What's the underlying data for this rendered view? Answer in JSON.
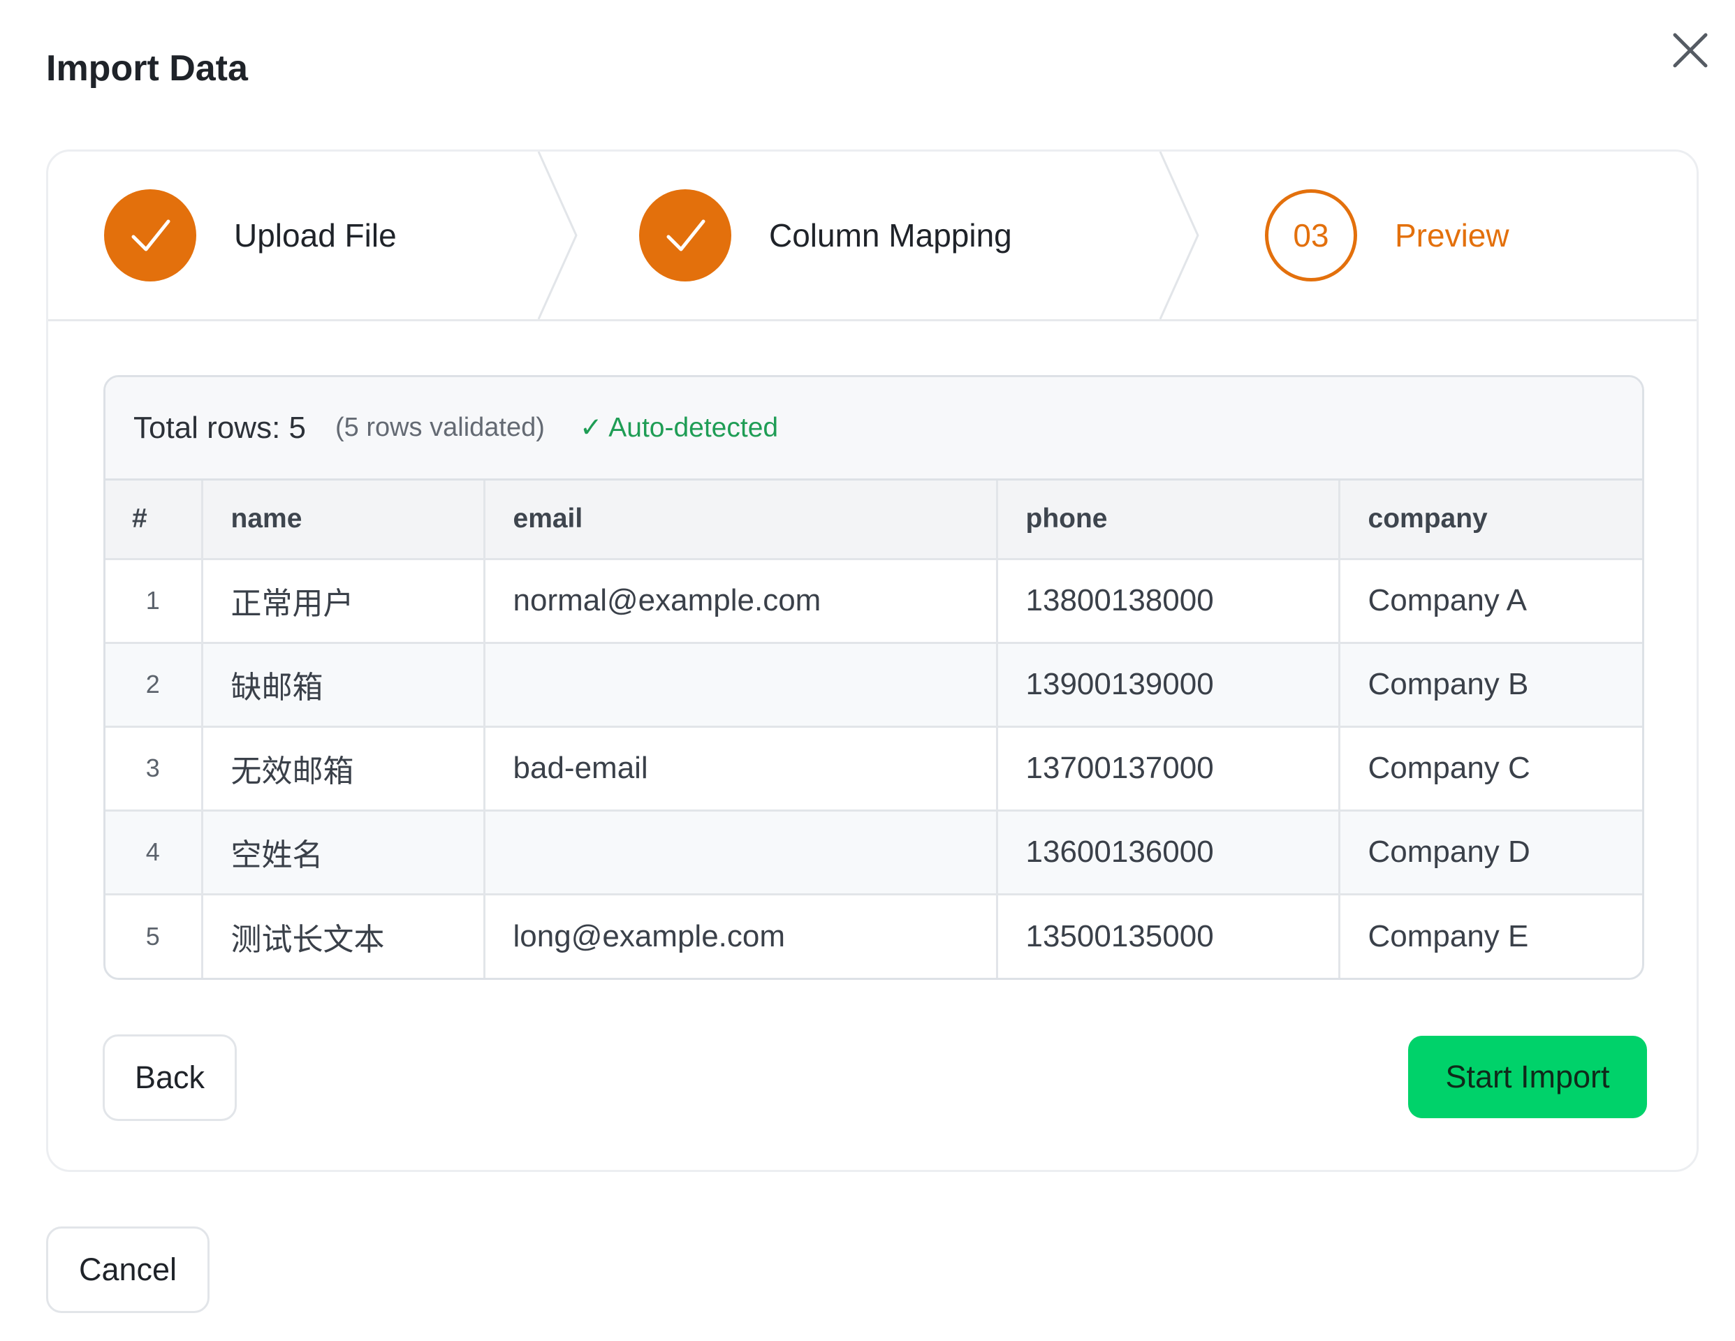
{
  "dialog": {
    "title": "Import Data",
    "close_icon": "close-icon"
  },
  "steps": [
    {
      "label": "Upload File",
      "state": "done",
      "icon": "check-icon"
    },
    {
      "label": "Column Mapping",
      "state": "done",
      "icon": "check-icon"
    },
    {
      "number": "03",
      "label": "Preview",
      "state": "current"
    }
  ],
  "preview": {
    "total_rows": "Total rows: 5",
    "validated": "(5 rows validated)",
    "auto_detected": "✓ Auto-detected",
    "columns": [
      "#",
      "name",
      "email",
      "phone",
      "company"
    ],
    "rows": [
      [
        "1",
        "正常用户",
        "normal@example.com",
        "13800138000",
        "Company A"
      ],
      [
        "2",
        "缺邮箱",
        "",
        "13900139000",
        "Company B"
      ],
      [
        "3",
        "无效邮箱",
        "bad-email",
        "13700137000",
        "Company C"
      ],
      [
        "4",
        "空姓名",
        "",
        "13600136000",
        "Company D"
      ],
      [
        "5",
        "测试长文本",
        "long@example.com",
        "13500135000",
        "Company E"
      ]
    ]
  },
  "buttons": {
    "back": "Back",
    "start_import": "Start Import",
    "cancel": "Cancel"
  },
  "colors": {
    "accent": "#e3700c",
    "success_text": "#1f9d55",
    "primary_button": "#00d26a"
  }
}
